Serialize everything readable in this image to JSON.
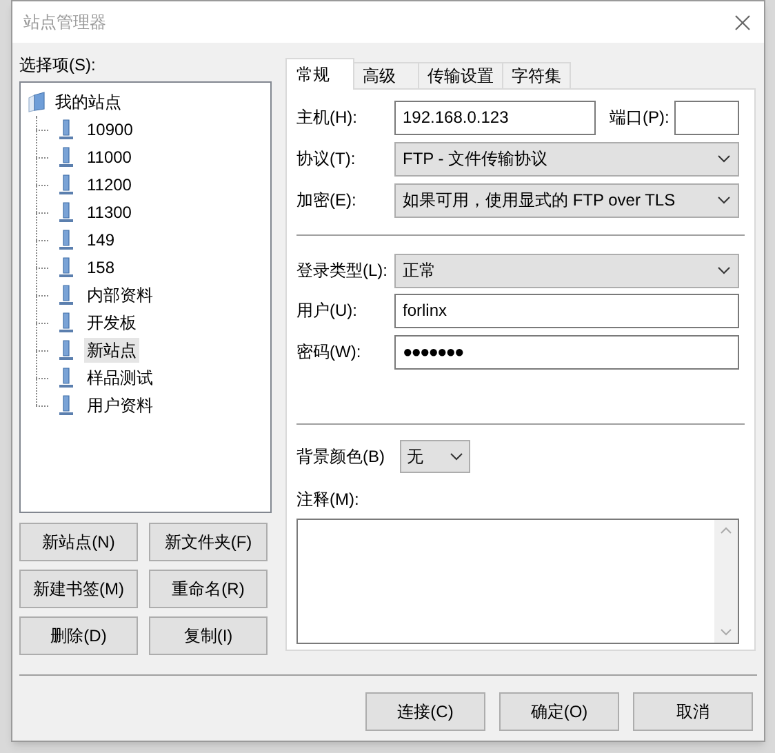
{
  "window": {
    "title": "站点管理器"
  },
  "select_label": "选择项(S):",
  "tree": {
    "label": "我的站点",
    "expanded": true,
    "children": [
      {
        "label": "10900",
        "selected": false
      },
      {
        "label": "11000",
        "selected": false
      },
      {
        "label": "11200",
        "selected": false
      },
      {
        "label": "11300",
        "selected": false
      },
      {
        "label": "149",
        "selected": false
      },
      {
        "label": "158",
        "selected": false
      },
      {
        "label": "内部资料",
        "selected": false
      },
      {
        "label": "开发板",
        "selected": false
      },
      {
        "label": "新站点",
        "selected": true
      },
      {
        "label": "样品测试",
        "selected": false
      },
      {
        "label": "用户资料",
        "selected": false
      }
    ]
  },
  "site_buttons": [
    "新站点(N)",
    "新文件夹(F)",
    "新建书签(M)",
    "重命名(R)",
    "删除(D)",
    "复制(I)"
  ],
  "tabs": [
    {
      "label": "常规",
      "selected": true
    },
    {
      "label": "高级",
      "selected": false
    },
    {
      "label": "传输设置",
      "selected": false
    },
    {
      "label": "字符集",
      "selected": false
    }
  ],
  "host": {
    "label": "主机(H):",
    "value": "192.168.0.123"
  },
  "port": {
    "label": "端口(P):"
  },
  "protocol": {
    "label": "协议(T):",
    "value": "FTP - 文件传输协议"
  },
  "encryption": {
    "label": "加密(E):",
    "value": "如果可用，使用显式的 FTP over TLS"
  },
  "logon_type": {
    "label": "登录类型(L):",
    "value": "正常"
  },
  "user": {
    "label": "用户(U):",
    "value": "forlinx"
  },
  "password": {
    "label": "密码(W):",
    "value": "●●●●●●●"
  },
  "background_color": {
    "label": "背景颜色(B)",
    "value": "无"
  },
  "comments": {
    "label": "注释(M):"
  },
  "buttons": [
    "连接(C)",
    "确定(O)",
    "取消"
  ]
}
